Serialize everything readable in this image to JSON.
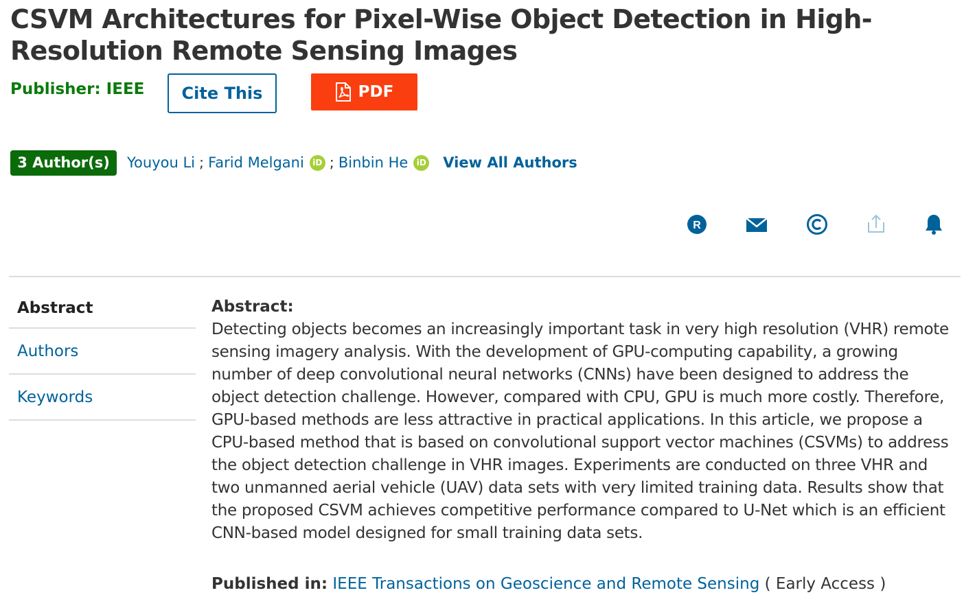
{
  "article": {
    "title": "CSVM Architectures for Pixel-Wise Object Detection in High-Resolution Remote Sensing Images",
    "publisher": "Publisher: IEEE"
  },
  "buttons": {
    "cite": "Cite This",
    "pdf": "PDF"
  },
  "authors": {
    "count_label": "3 Author(s)",
    "list": [
      {
        "name": "Youyou Li",
        "orcid": false
      },
      {
        "name": "Farid Melgani",
        "orcid": true
      },
      {
        "name": "Binbin He",
        "orcid": true
      }
    ],
    "separator": ";",
    "orcid_label": "iD",
    "view_all": "View All Authors"
  },
  "actions": {
    "icons": [
      "rights-icon",
      "email-icon",
      "copyright-icon",
      "share-icon",
      "alert-bell-icon"
    ],
    "rights_letter": "R",
    "accent_color": "#00629b"
  },
  "nav": {
    "items": [
      "Abstract",
      "Authors",
      "Keywords"
    ]
  },
  "abstract": {
    "heading": "Abstract:",
    "text": "Detecting objects becomes an increasingly important task in very high resolution (VHR) remote sensing imagery analysis. With the development of GPU-computing capability, a growing number of deep convolutional neural networks (CNNs) have been designed to address the object detection challenge. However, compared with CPU, GPU is much more costly. Therefore, GPU-based methods are less attractive in practical applications. In this article, we propose a CPU-based method that is based on convolutional support vector machines (CSVMs) to address the object detection challenge in VHR images. Experiments are conducted on three VHR and two unmanned aerial vehicle (UAV) data sets with very limited training data. Results show that the proposed CSVM achieves competitive performance compared to U-Net which is an efficient CNN-based model designed for small training data sets."
  },
  "published": {
    "label": "Published in:",
    "journal": "IEEE Transactions on Geoscience and Remote Sensing",
    "status": "( Early Access )"
  }
}
